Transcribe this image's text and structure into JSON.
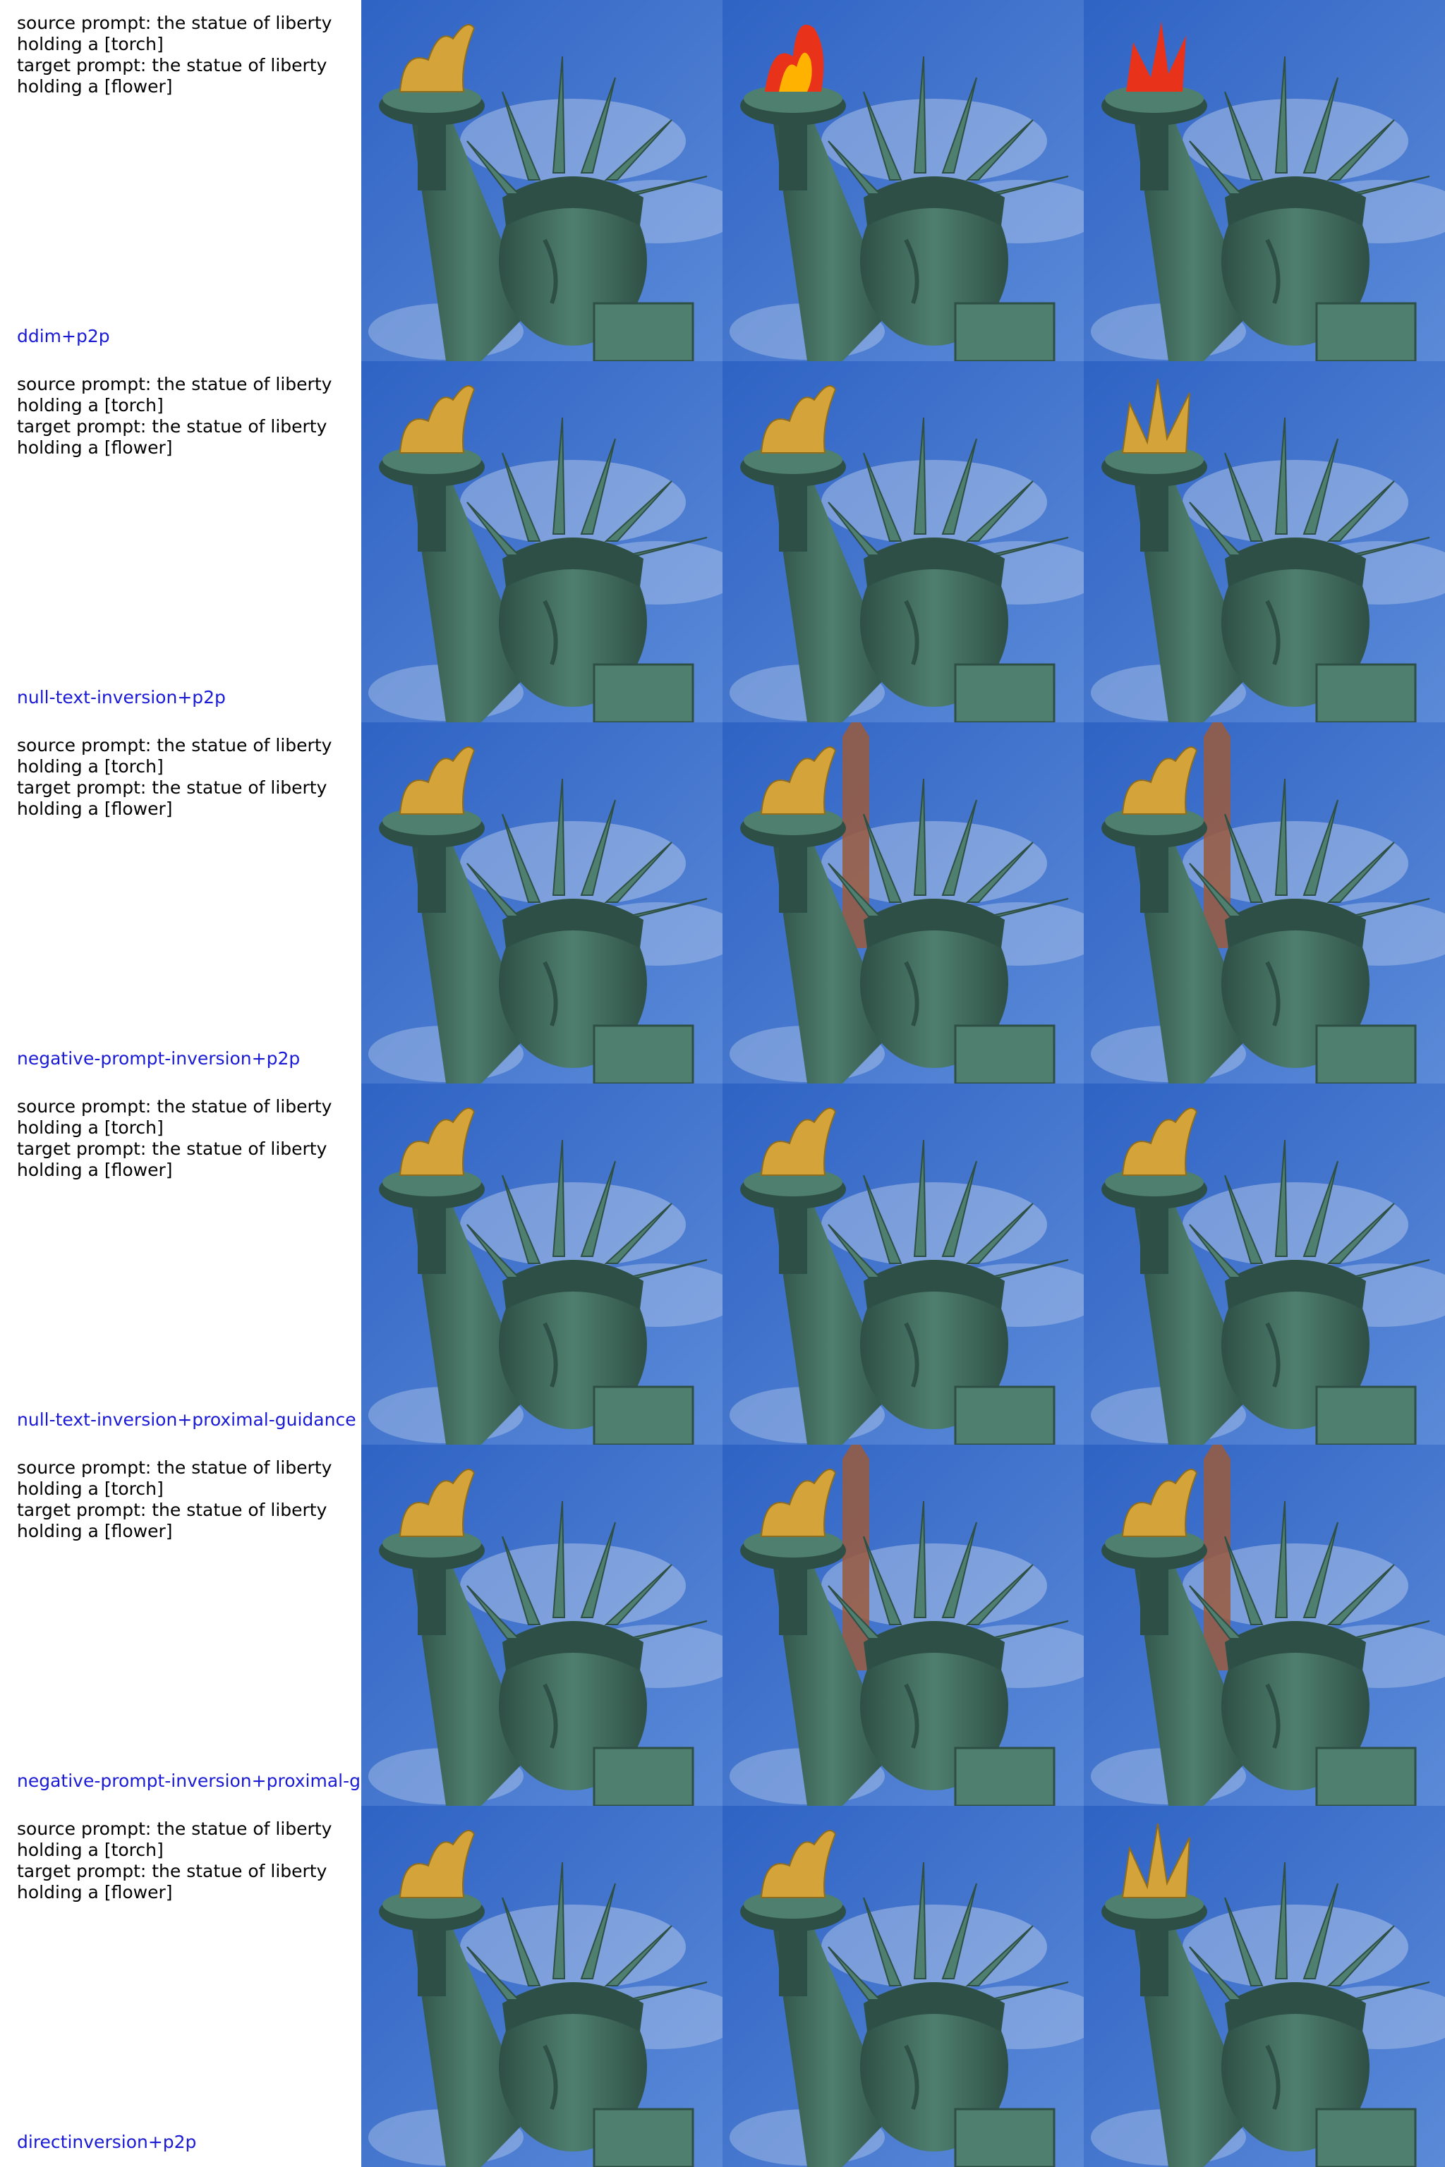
{
  "rows": [
    {
      "source_prompt": "source prompt: the statue of liberty\nholding a [torch]",
      "target_prompt": "target prompt: the statue of liberty\nholding a [flower]",
      "method": "ddim+p2p",
      "images": [
        {
          "description": "statue-of-liberty-source",
          "variant": "source"
        },
        {
          "description": "statue-of-liberty-reconstruction-flame-torch",
          "variant": "flame"
        },
        {
          "description": "statue-of-liberty-edited-red-flower",
          "variant": "redflower"
        }
      ]
    },
    {
      "source_prompt": "source prompt: the statue of liberty\nholding a [torch]",
      "target_prompt": "target prompt: the statue of liberty\nholding a [flower]",
      "method": "null-text-inversion+p2p",
      "images": [
        {
          "description": "statue-of-liberty-source",
          "variant": "source"
        },
        {
          "description": "statue-of-liberty-reconstruction",
          "variant": "source"
        },
        {
          "description": "statue-of-liberty-edited-flower",
          "variant": "yellowflower"
        }
      ]
    },
    {
      "source_prompt": "source prompt: the statue of liberty\nholding a [torch]",
      "target_prompt": "target prompt: the statue of liberty\nholding a [flower]",
      "method": "negative-prompt-inversion+p2p",
      "images": [
        {
          "description": "statue-of-liberty-source",
          "variant": "source"
        },
        {
          "description": "statue-of-liberty-reconstruction-with-tower",
          "variant": "tower"
        },
        {
          "description": "statue-of-liberty-edited-with-tower",
          "variant": "tower"
        }
      ]
    },
    {
      "source_prompt": "source prompt: the statue of liberty\nholding a [torch]",
      "target_prompt": "target prompt: the statue of liberty\nholding a [flower]",
      "method": "null-text-inversion+proximal-guidance",
      "images": [
        {
          "description": "statue-of-liberty-source",
          "variant": "source"
        },
        {
          "description": "statue-of-liberty-reconstruction",
          "variant": "source"
        },
        {
          "description": "statue-of-liberty-edited",
          "variant": "source"
        }
      ]
    },
    {
      "source_prompt": "source prompt: the statue of liberty\nholding a [torch]",
      "target_prompt": "target prompt: the statue of liberty\nholding a [flower]",
      "method": "negative-prompt-inversion+proximal-g",
      "images": [
        {
          "description": "statue-of-liberty-source",
          "variant": "source"
        },
        {
          "description": "statue-of-liberty-reconstruction-with-tower",
          "variant": "tower"
        },
        {
          "description": "statue-of-liberty-edited-with-tower",
          "variant": "tower"
        }
      ]
    },
    {
      "source_prompt": "source prompt: the statue of liberty\nholding a [torch]",
      "target_prompt": "target prompt: the statue of liberty\nholding a [flower]",
      "method": "directinversion+p2p",
      "images": [
        {
          "description": "statue-of-liberty-source",
          "variant": "source"
        },
        {
          "description": "statue-of-liberty-reconstruction",
          "variant": "source"
        },
        {
          "description": "statue-of-liberty-edited-flower",
          "variant": "yellowflower"
        }
      ]
    }
  ],
  "colors": {
    "sky": "#2f63c4",
    "sky_light": "#5b8ad8",
    "cloud": "#e8eef7",
    "statue": "#4f7f6e",
    "statue_dark": "#2e4f45",
    "gold": "#d4a43a",
    "flame_red": "#e8321a",
    "flame_yellow": "#ffb300",
    "tower": "#9b5a3c",
    "label_blue": "#1a1ad6"
  }
}
